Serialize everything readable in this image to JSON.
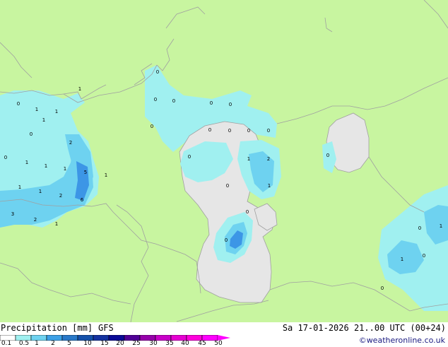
{
  "map": {
    "colors": {
      "land": "#c8f5a0",
      "sea_dry": "#e6e6e6",
      "precip_light": "#a0f0f0",
      "precip_medium": "#6ed2f0",
      "precip_heavy": "#3c96e6",
      "precip_heaviest": "#2872c8",
      "border": "#a0a0a0"
    },
    "value_labels": [
      "0",
      "1",
      "1",
      "1",
      "0",
      "0",
      "1",
      "1",
      "1",
      "1",
      "2",
      "5",
      "1",
      "1",
      "1",
      "2",
      "6",
      "3",
      "2",
      "1",
      "0",
      "0",
      "0",
      "0",
      "0",
      "0",
      "0",
      "0",
      "0",
      "0",
      "1",
      "2",
      "0",
      "1",
      "0",
      "0",
      "0",
      "0",
      "1",
      "0",
      "1",
      "0",
      "0"
    ]
  },
  "footer": {
    "title": "Precipitation [mm]",
    "model": "GFS",
    "datetime": "Sa 17-01-2026 21..00 UTC (00+24)",
    "credit": "©weatheronline.co.uk",
    "colorbar": {
      "labels": [
        "0.1",
        "0.5",
        "1",
        "2",
        "5",
        "10",
        "15",
        "20",
        "25",
        "30",
        "35",
        "40",
        "45",
        "50"
      ],
      "colors": [
        "#ffffff",
        "#a0f0f0",
        "#6ed2f0",
        "#3ca0e6",
        "#2878c8",
        "#1450aa",
        "#1432a0",
        "#0a0a96",
        "#500096",
        "#9600aa",
        "#c800c8",
        "#e600d2",
        "#ff00dc",
        "#ff00ff"
      ]
    }
  }
}
